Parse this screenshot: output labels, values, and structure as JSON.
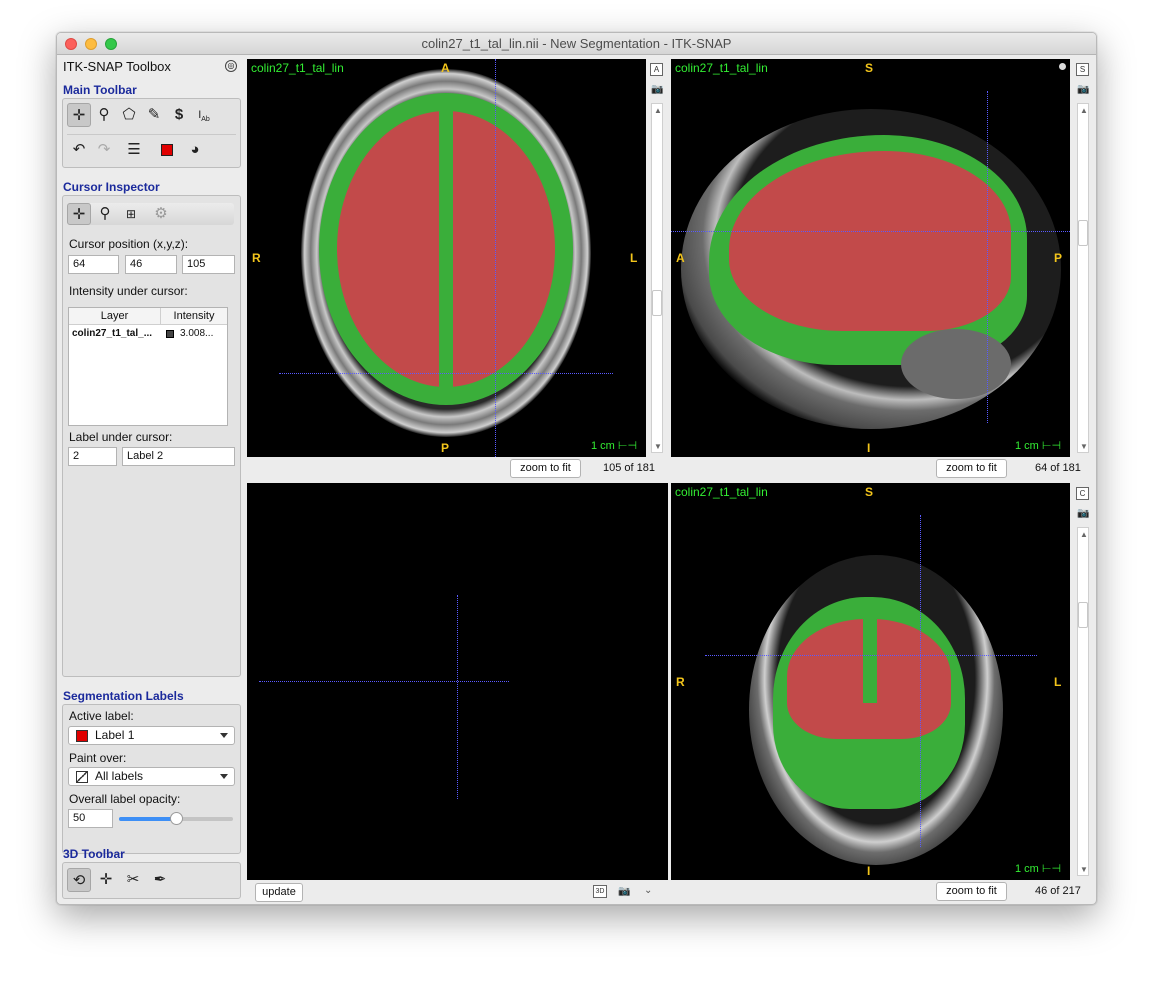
{
  "window": {
    "title": "colin27_t1_tal_lin.nii - New Segmentation - ITK-SNAP"
  },
  "toolbox": {
    "title": "ITK-SNAP Toolbox",
    "main_toolbar": {
      "title": "Main Toolbar",
      "tools": [
        "crosshair-icon",
        "zoom-icon",
        "polygon-icon",
        "paintbrush-icon",
        "snake-icon",
        "annotation-icon"
      ],
      "actions": [
        "undo-icon",
        "redo-icon",
        "layers-icon",
        "label-color-icon",
        "palette-icon"
      ]
    },
    "cursor_inspector": {
      "title": "Cursor Inspector",
      "position_label": "Cursor position (x,y,z):",
      "x": "64",
      "y": "46",
      "z": "105",
      "intensity_label": "Intensity under cursor:",
      "table_headers": [
        "Layer",
        "Intensity"
      ],
      "rows": [
        {
          "layer": "colin27_t1_tal_...",
          "intensity": "3.008..."
        }
      ],
      "label_under_label": "Label under cursor:",
      "label_id": "2",
      "label_name": "Label 2"
    },
    "segmentation_labels": {
      "title": "Segmentation Labels",
      "active_label_label": "Active label:",
      "active_label": "Label 1",
      "active_color": "#e00000",
      "paint_over_label": "Paint over:",
      "paint_over": "All labels",
      "opacity_label": "Overall label opacity:",
      "opacity": "50",
      "opacity_fraction": 0.5
    },
    "toolbar_3d": {
      "title": "3D Toolbar"
    }
  },
  "views": {
    "axial": {
      "layer": "colin27_t1_tal_lin",
      "top": "A",
      "bottom": "P",
      "left": "R",
      "right": "L",
      "scale": "1 cm",
      "slice": "105 of 181",
      "zoom": "zoom to fit",
      "badge": "A"
    },
    "sagittal": {
      "layer": "colin27_t1_tal_lin",
      "top": "S",
      "bottom": "I",
      "left": "A",
      "right": "P",
      "scale": "1 cm",
      "slice": "64 of 181",
      "zoom": "zoom to fit",
      "badge": "S"
    },
    "coronal": {
      "layer": "colin27_t1_tal_lin",
      "top": "S",
      "bottom": "I",
      "left": "R",
      "right": "L",
      "scale": "1 cm",
      "slice": "46 of 217",
      "zoom": "zoom to fit",
      "badge": "C"
    },
    "three_d": {
      "update": "update",
      "badge": "3D"
    }
  },
  "colors": {
    "label1": "#c24a4a",
    "label2": "#3aae3a",
    "crosshair": "#5a5aff",
    "view_text": "#33ee33",
    "orient": "#f3c51b",
    "section_title": "#1b2a9c"
  }
}
